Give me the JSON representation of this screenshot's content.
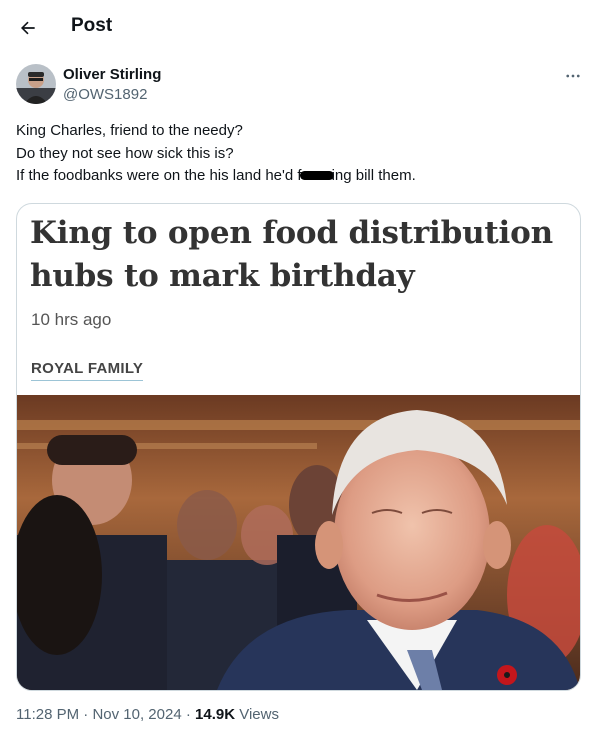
{
  "header": {
    "title": "Post"
  },
  "author": {
    "name": "Oliver Stirling",
    "handle": "@OWS1892"
  },
  "tweet": {
    "line1": "King Charles, friend to the needy?",
    "line2": "Do they not see how sick this is?",
    "line3_start": "If the foodbanks were on the his land he'd f",
    "line3_end": "ing bill them."
  },
  "card": {
    "headline": "King to open food distribution hubs to mark birthday",
    "time": "10 hrs ago",
    "category": "ROYAL FAMILY"
  },
  "meta": {
    "time": "11:28 PM",
    "separator1": " · ",
    "date": "Nov 10, 2024",
    "separator2": " · ",
    "views_count": "14.9K",
    "views_label": " Views"
  },
  "colors": {
    "text": "#0f1419",
    "secondary": "#536471",
    "border": "#cfd9de",
    "headline": "#333333"
  }
}
